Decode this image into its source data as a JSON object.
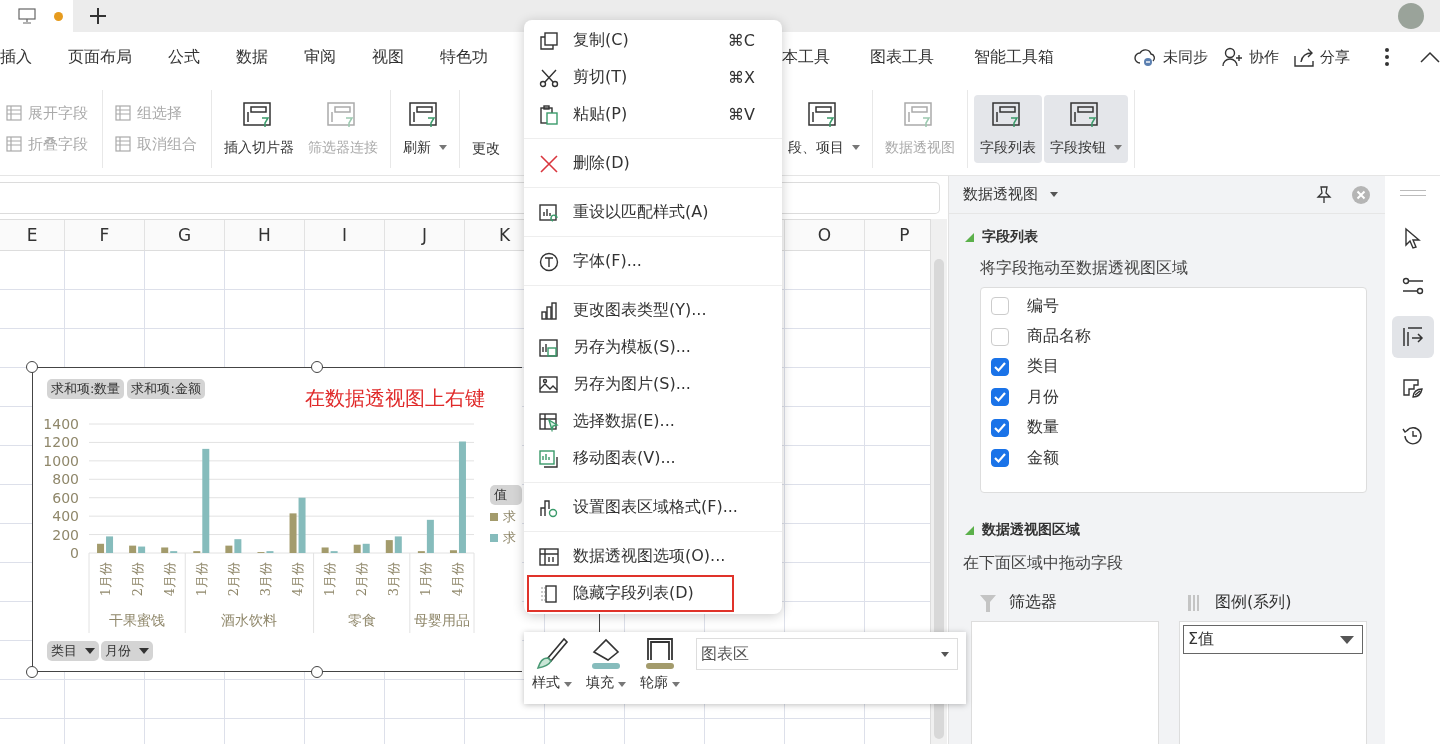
{
  "tabbar": {
    "unsaved": true
  },
  "menubar": {
    "left": [
      "插入",
      "页面布局",
      "公式",
      "数据",
      "审阅",
      "视图",
      "特色功"
    ],
    "right": [
      "本工具",
      "图表工具",
      "智能工具箱"
    ],
    "actions": [
      {
        "kind": "sync",
        "label": "未同步"
      },
      {
        "kind": "collab",
        "label": "协作"
      },
      {
        "kind": "share",
        "label": "分享"
      }
    ]
  },
  "ribbon": {
    "left": [
      {
        "kind": "small",
        "items": [
          {
            "label": "展开字段",
            "disabled": true
          },
          {
            "label": "折叠字段",
            "disabled": true
          }
        ]
      },
      {
        "kind": "small",
        "items": [
          {
            "label": "组选择",
            "disabled": true
          },
          {
            "label": "取消组合",
            "disabled": true
          }
        ]
      },
      {
        "kind": "large",
        "items": [
          {
            "label": "插入切片器",
            "disabled": false,
            "dropdown": false,
            "selected": false
          },
          {
            "label": "筛选器连接",
            "disabled": true,
            "dropdown": false,
            "selected": false
          }
        ]
      },
      {
        "kind": "large",
        "items": [
          {
            "label": "刷新",
            "disabled": false,
            "dropdown": true,
            "selected": false
          }
        ]
      },
      {
        "kind": "text",
        "items": [
          {
            "label": "更改",
            "disabled": false
          }
        ]
      }
    ],
    "right": [
      {
        "kind": "large",
        "items": [
          {
            "label": "段、项目",
            "disabled": false,
            "dropdown": true,
            "selected": false
          }
        ]
      },
      {
        "kind": "large",
        "items": [
          {
            "label": "数据透视图",
            "disabled": true,
            "dropdown": false,
            "selected": false
          }
        ]
      },
      {
        "kind": "large",
        "items": [
          {
            "label": "字段列表",
            "disabled": false,
            "dropdown": false,
            "selected": true
          },
          {
            "label": "字段按钮",
            "disabled": false,
            "dropdown": true,
            "selected": true
          }
        ]
      }
    ]
  },
  "sheet": {
    "columns_left": [
      "E",
      "F",
      "G",
      "H",
      "I",
      "J",
      "K"
    ],
    "columns_right": [
      "O",
      "P"
    ]
  },
  "chart": {
    "title": "在数据透视图上右键",
    "axis_fields": [
      "类目",
      "月份"
    ],
    "value_fields": [
      "求和项:数量",
      "求和项:金额"
    ],
    "legend": {
      "title": "值"
    },
    "category_groups": [
      {
        "label": "干果蜜饯",
        "categories": [
          "1月份",
          "2月份",
          "4月份"
        ]
      },
      {
        "label": "酒水饮料",
        "categories": [
          "1月份",
          "2月份",
          "3月份",
          "4月份"
        ]
      },
      {
        "label": "零食",
        "categories": [
          "1月份",
          "2月份",
          "3月份"
        ]
      },
      {
        "label": "母婴用品",
        "categories": [
          "1月份",
          "4月份"
        ]
      }
    ],
    "chart_data": {
      "type": "bar",
      "stacked": false,
      "grid": true,
      "series": [
        {
          "name": "求",
          "color": "#a39b6c",
          "values": [
            100,
            80,
            60,
            20,
            80,
            10,
            430,
            60,
            90,
            140,
            20,
            30
          ]
        },
        {
          "name": "求",
          "color": "#86bcbc",
          "values": [
            180,
            70,
            20,
            1130,
            150,
            20,
            600,
            20,
            100,
            180,
            360,
            1210
          ]
        }
      ],
      "ylim": [
        0,
        1400
      ],
      "yticks": [
        0,
        200,
        400,
        600,
        800,
        1000,
        1200,
        1400
      ]
    }
  },
  "context_menu": {
    "items": [
      {
        "kind": "item",
        "label": "复制(C)",
        "shortcut": "⌘C",
        "highlighted": false
      },
      {
        "kind": "item",
        "label": "剪切(T)",
        "shortcut": "⌘X",
        "highlighted": false
      },
      {
        "kind": "item",
        "label": "粘贴(P)",
        "shortcut": "⌘V",
        "highlighted": false
      },
      {
        "kind": "separator"
      },
      {
        "kind": "item",
        "label": "删除(D)",
        "highlighted": false
      },
      {
        "kind": "separator"
      },
      {
        "kind": "item",
        "label": "重设以匹配样式(A)",
        "highlighted": false
      },
      {
        "kind": "separator"
      },
      {
        "kind": "item",
        "label": "字体(F)...",
        "highlighted": false
      },
      {
        "kind": "separator"
      },
      {
        "kind": "item",
        "label": "更改图表类型(Y)...",
        "highlighted": false
      },
      {
        "kind": "item",
        "label": "另存为模板(S)...",
        "highlighted": false
      },
      {
        "kind": "item",
        "label": "另存为图片(S)...",
        "highlighted": false
      },
      {
        "kind": "item",
        "label": "选择数据(E)...",
        "highlighted": false
      },
      {
        "kind": "item",
        "label": "移动图表(V)...",
        "highlighted": false
      },
      {
        "kind": "separator"
      },
      {
        "kind": "item",
        "label": "设置图表区域格式(F)...",
        "highlighted": false
      },
      {
        "kind": "separator"
      },
      {
        "kind": "item",
        "label": "数据透视图选项(O)...",
        "highlighted": false
      },
      {
        "kind": "item",
        "label": "隐藏字段列表(D)",
        "highlighted": true
      }
    ]
  },
  "mini_toolbar": {
    "buttons": [
      {
        "kind": "style",
        "label": "样式"
      },
      {
        "kind": "fill",
        "label": "填充"
      },
      {
        "kind": "outline",
        "label": "轮廓"
      }
    ],
    "element_select": {
      "value": "图表区"
    }
  },
  "panel": {
    "title": "数据透视图",
    "field_section": {
      "title": "字段列表",
      "expanded": true,
      "hint": "将字段拖动至数据透视图区域",
      "fields": [
        {
          "label": "编号",
          "checked": false
        },
        {
          "label": "商品名称",
          "checked": false
        },
        {
          "label": "类目",
          "checked": true
        },
        {
          "label": "月份",
          "checked": true
        },
        {
          "label": "数量",
          "checked": true
        },
        {
          "label": "金额",
          "checked": true
        }
      ]
    },
    "area_section": {
      "title": "数据透视图区域",
      "expanded": true,
      "hint": "在下面区域中拖动字段",
      "areas": [
        {
          "kind": "filter",
          "label": "筛选器"
        },
        {
          "kind": "legend",
          "label": "图例(系列)",
          "items": [
            "Σ值"
          ]
        }
      ]
    }
  },
  "sidebar": {
    "tools": [
      {
        "kind": "cursor",
        "selected": false
      },
      {
        "kind": "sliders",
        "selected": false
      },
      {
        "kind": "pivot",
        "selected": true
      },
      {
        "kind": "shapes",
        "selected": false
      },
      {
        "kind": "history",
        "selected": false
      }
    ]
  }
}
